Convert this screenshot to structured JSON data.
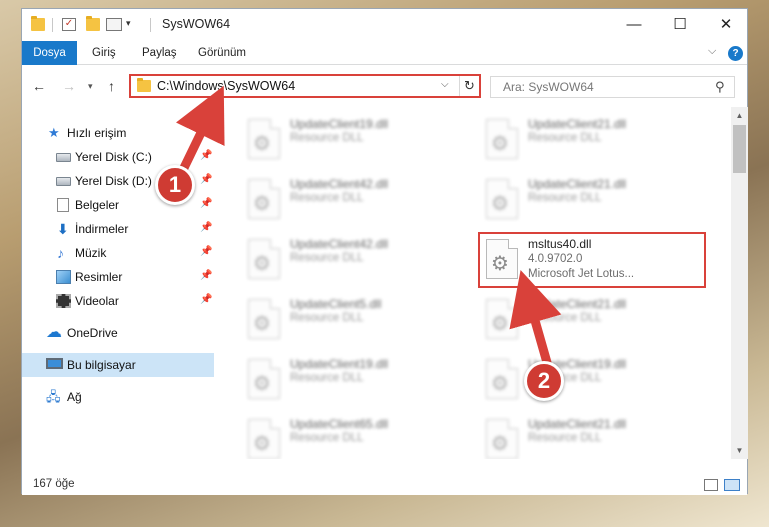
{
  "window": {
    "title": "SysWOW64",
    "quick_access_dropdown": "▾",
    "controls": {
      "minimize": "—",
      "maximize": "☐",
      "close": "✕"
    }
  },
  "ribbon": {
    "tabs": [
      {
        "label": "Dosya"
      },
      {
        "label": "Giriş"
      },
      {
        "label": "Paylaş"
      },
      {
        "label": "Görünüm"
      }
    ],
    "help": "?"
  },
  "address": {
    "path": "C:\\Windows\\SysWOW64",
    "search_placeholder": "Ara: SysWOW64"
  },
  "navigation": {
    "items": [
      {
        "label": "Hızlı erişim",
        "icon": "star-icon",
        "pinned": false
      },
      {
        "label": "Yerel Disk (C:)",
        "icon": "drive-icon",
        "pinned": true
      },
      {
        "label": "Yerel Disk (D:)",
        "icon": "drive-icon",
        "pinned": true
      },
      {
        "label": "Belgeler",
        "icon": "documents-icon",
        "pinned": true
      },
      {
        "label": "İndirmeler",
        "icon": "download-icon",
        "pinned": true
      },
      {
        "label": "Müzik",
        "icon": "music-icon",
        "pinned": true
      },
      {
        "label": "Resimler",
        "icon": "pictures-icon",
        "pinned": true
      },
      {
        "label": "Videolar",
        "icon": "videos-icon",
        "pinned": true
      },
      {
        "label": "OneDrive",
        "icon": "onedrive-icon",
        "pinned": false
      },
      {
        "label": "Bu bilgisayar",
        "icon": "computer-icon",
        "pinned": false,
        "selected": true
      },
      {
        "label": "Ağ",
        "icon": "network-icon",
        "pinned": false
      }
    ]
  },
  "files": [
    {
      "name": "UpdateClient19.dll",
      "desc": "Resource DLL",
      "blurred": true
    },
    {
      "name": "UpdateClient21.dll",
      "desc": "Resource DLL",
      "blurred": true
    },
    {
      "name": "UpdateClient42.dll",
      "desc": "Resource DLL",
      "blurred": true
    },
    {
      "name": "UpdateClient21.dll",
      "desc": "Resource DLL",
      "blurred": true
    },
    {
      "name": "UpdateClient42.dll",
      "desc": "Resource DLL",
      "blurred": true
    },
    {
      "name": "msltus40.dll",
      "desc": "4.0.9702.0",
      "sub": "Microsoft Jet Lotus...",
      "blurred": false,
      "highlighted": true
    },
    {
      "name": "UpdateClient5.dll",
      "desc": "Resource DLL",
      "blurred": true
    },
    {
      "name": "UpdateClient21.dll",
      "desc": "Resource DLL",
      "blurred": true
    },
    {
      "name": "UpdateClient19.dll",
      "desc": "Resource DLL",
      "blurred": true
    },
    {
      "name": "UpdateClient19.dll",
      "desc": "Resource DLL",
      "blurred": true
    },
    {
      "name": "UpdateClient65.dll",
      "desc": "Resource DLL",
      "blurred": true
    },
    {
      "name": "UpdateClient21.dll",
      "desc": "Resource DLL",
      "blurred": true
    }
  ],
  "status": {
    "count": "167 öğe"
  },
  "annotations": {
    "step1": "1",
    "step2": "2",
    "color": "#d9413a"
  }
}
